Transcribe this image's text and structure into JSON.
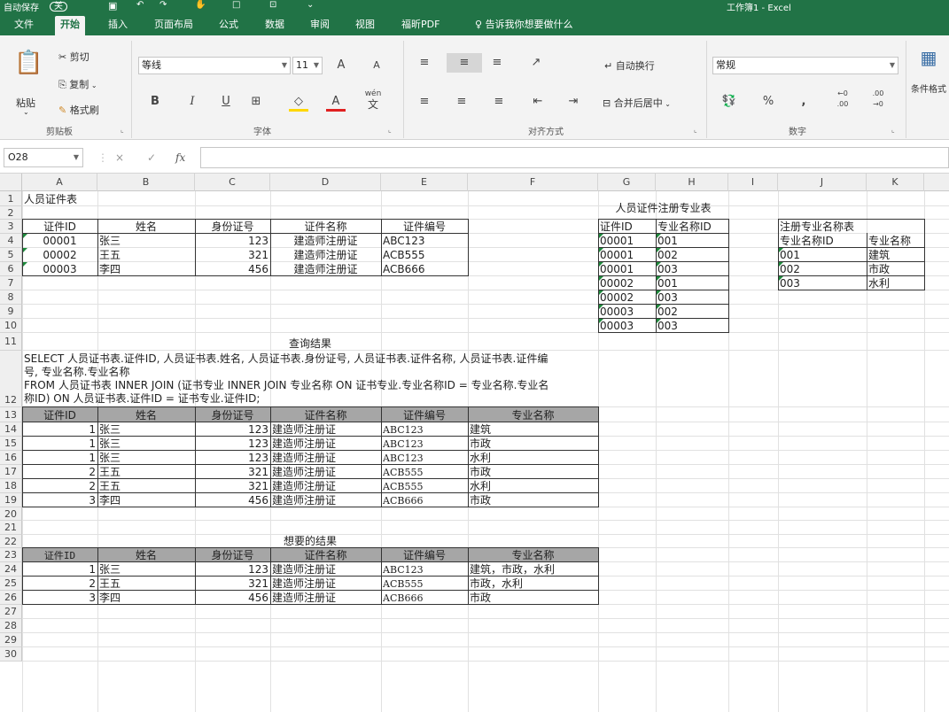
{
  "titlebar": {
    "autosave": "自动保存",
    "autosave_state": "关",
    "quick_icons": [
      "save-icon",
      "undo-icon",
      "redo-icon",
      "touch-icon",
      "new-icon",
      "preview-icon",
      "customize-icon"
    ],
    "doc_title": "工作簿1 - Excel"
  },
  "tabs": [
    "文件",
    "开始",
    "插入",
    "页面布局",
    "公式",
    "数据",
    "审阅",
    "视图",
    "福昕PDF"
  ],
  "tell_me": "告诉我你想要做什么",
  "ribbon": {
    "clipboard": {
      "paste": "粘贴",
      "cut": "剪切",
      "copy": "复制",
      "format_painter": "格式刷",
      "group": "剪贴板"
    },
    "font": {
      "name": "等线",
      "size": "11",
      "bold": "B",
      "italic": "I",
      "underline": "U",
      "grow": "A",
      "shrink": "A",
      "wen": "wén",
      "wen_char": "文",
      "group": "字体"
    },
    "align": {
      "wrap": "自动换行",
      "merge": "合并后居中",
      "group": "对齐方式"
    },
    "number": {
      "format": "常规",
      "percent": "%",
      "comma": ",",
      "inc": ".00",
      "dec": ".00",
      "inc_sub": "←0",
      "dec_sub": "→0",
      "group": "数字"
    },
    "styles": {
      "conditional": "条件格式"
    }
  },
  "formula": {
    "namebox": "O28",
    "fx": "fx",
    "cancel": "×",
    "enter": "✓",
    "value": ""
  },
  "columns": [
    "A",
    "B",
    "C",
    "D",
    "E",
    "F",
    "G",
    "H",
    "I",
    "J",
    "K"
  ],
  "rows": [
    "1",
    "2",
    "3",
    "4",
    "5",
    "6",
    "7",
    "8",
    "9",
    "10",
    "11",
    "12",
    "13",
    "14",
    "15",
    "16",
    "17",
    "18",
    "19",
    "20",
    "21",
    "22",
    "23",
    "24",
    "25",
    "26",
    "27",
    "28",
    "29",
    "30"
  ],
  "person_table": {
    "title": "人员证件表",
    "headers": [
      "证件ID",
      "姓名",
      "身份证号",
      "证件名称",
      "证件编号"
    ],
    "rows": [
      [
        "00001",
        "张三",
        "123",
        "建造师注册证",
        "ABC123"
      ],
      [
        "00002",
        "王五",
        "321",
        "建造师注册证",
        "ACB555"
      ],
      [
        "00003",
        "李四",
        "456",
        "建造师注册证",
        "ACB666"
      ]
    ]
  },
  "reg_table": {
    "title": "人员证件注册专业表",
    "headers": [
      "证件ID",
      "专业名称ID"
    ],
    "rows": [
      [
        "00001",
        "001"
      ],
      [
        "00001",
        "002"
      ],
      [
        "00001",
        "003"
      ],
      [
        "00002",
        "001"
      ],
      [
        "00002",
        "003"
      ],
      [
        "00003",
        "002"
      ],
      [
        "00003",
        "003"
      ]
    ]
  },
  "major_table": {
    "title": "注册专业名称表",
    "headers": [
      "专业名称ID",
      "专业名称"
    ],
    "rows": [
      [
        "001",
        "建筑"
      ],
      [
        "002",
        "市政"
      ],
      [
        "003",
        "水利"
      ]
    ]
  },
  "query": {
    "label": "查询结果",
    "sql_lines": [
      "SELECT 人员证书表.证件ID, 人员证书表.姓名, 人员证书表.身份证号, 人员证书表.证件名称, 人员证书表.证件编",
      "号, 专业名称.专业名称",
      "FROM 人员证书表 INNER JOIN (证书专业 INNER JOIN 专业名称 ON 证书专业.专业名称ID = 专业名称.专业名",
      "称ID) ON 人员证书表.证件ID = 证书专业.证件ID;"
    ],
    "headers": [
      "证件ID",
      "姓名",
      "身份证号",
      "证件名称",
      "证件编号",
      "专业名称"
    ],
    "rows": [
      [
        "1",
        "张三",
        "123",
        "建造师注册证",
        "ABC123",
        "建筑"
      ],
      [
        "1",
        "张三",
        "123",
        "建造师注册证",
        "ABC123",
        "市政"
      ],
      [
        "1",
        "张三",
        "123",
        "建造师注册证",
        "ABC123",
        "水利"
      ],
      [
        "2",
        "王五",
        "321",
        "建造师注册证",
        "ACB555",
        "市政"
      ],
      [
        "2",
        "王五",
        "321",
        "建造师注册证",
        "ACB555",
        "水利"
      ],
      [
        "3",
        "李四",
        "456",
        "建造师注册证",
        "ACB666",
        "市政"
      ]
    ]
  },
  "wanted": {
    "label": "想要的结果",
    "headers": [
      "证件ID",
      "姓名",
      "身份证号",
      "证件名称",
      "证件编号",
      "专业名称"
    ],
    "rows": [
      [
        "1",
        "张三",
        "123",
        "建造师注册证",
        "ABC123",
        "建筑，市政，水利"
      ],
      [
        "2",
        "王五",
        "321",
        "建造师注册证",
        "ACB555",
        "市政，水利"
      ],
      [
        "3",
        "李四",
        "456",
        "建造师注册证",
        "ACB666",
        "市政"
      ]
    ]
  },
  "colors": {
    "excel_green": "#217346",
    "header_gray": "#a6a6a6",
    "font_red": "#e02020",
    "highlight_yellow": "#ffd700"
  }
}
